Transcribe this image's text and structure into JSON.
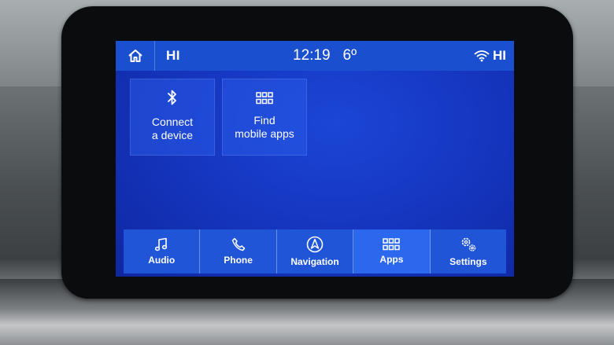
{
  "status": {
    "left_label": "HI",
    "time": "12:19",
    "temperature": "6º",
    "right_label": "HI"
  },
  "tiles": [
    {
      "label": "Connect\na device",
      "icon": "bluetooth-icon"
    },
    {
      "label": "Find\nmobile apps",
      "icon": "apps-grid-icon"
    }
  ],
  "nav": [
    {
      "label": "Audio",
      "icon": "music-note-icon"
    },
    {
      "label": "Phone",
      "icon": "phone-icon"
    },
    {
      "label": "Navigation",
      "icon": "navigation-arrow-icon"
    },
    {
      "label": "Apps",
      "icon": "apps-grid-icon",
      "active": true
    },
    {
      "label": "Settings",
      "icon": "gears-icon"
    }
  ],
  "colors": {
    "screen": "#1637c2",
    "statusbar": "#1a4fd0",
    "nav": "#1f55d6",
    "nav_active": "#2b68ee"
  }
}
